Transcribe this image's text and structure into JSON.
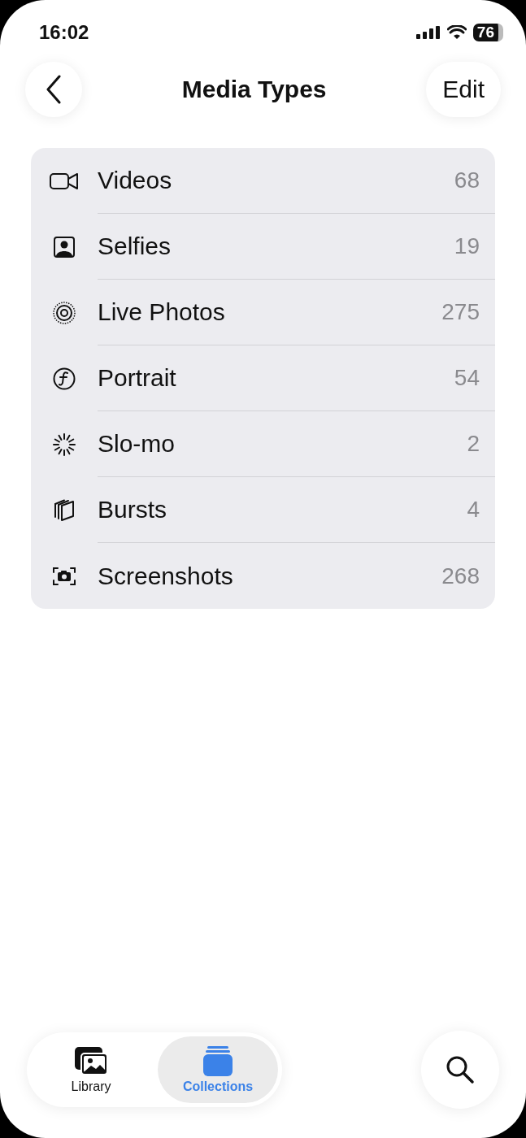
{
  "status_bar": {
    "time": "16:02",
    "battery": "76"
  },
  "nav": {
    "title": "Media Types",
    "edit": "Edit"
  },
  "media_types": [
    {
      "label": "Videos",
      "count": "68"
    },
    {
      "label": "Selfies",
      "count": "19"
    },
    {
      "label": "Live Photos",
      "count": "275"
    },
    {
      "label": "Portrait",
      "count": "54"
    },
    {
      "label": "Slo-mo",
      "count": "2"
    },
    {
      "label": "Bursts",
      "count": "4"
    },
    {
      "label": "Screenshots",
      "count": "268"
    }
  ],
  "tab_bar": [
    {
      "label": "Library",
      "selected": false
    },
    {
      "label": "Collections",
      "selected": true
    }
  ]
}
